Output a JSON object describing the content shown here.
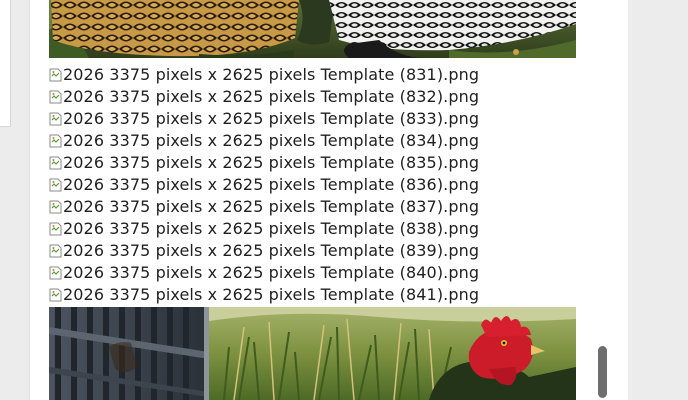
{
  "page": {
    "background": "#ececec",
    "card_background": "#ffffff"
  },
  "photos": {
    "top": {
      "icon": "chicken-photo",
      "subject": "speckled hens"
    },
    "bottom": {
      "icon": "rooster-photo",
      "subject": "rooster near fence"
    }
  },
  "broken_images": [
    {
      "alt": "2026 3375 pixels x 2625 pixels Template (831).png"
    },
    {
      "alt": "2026 3375 pixels x 2625 pixels Template (832).png"
    },
    {
      "alt": "2026 3375 pixels x 2625 pixels Template (833).png"
    },
    {
      "alt": "2026 3375 pixels x 2625 pixels Template (834).png"
    },
    {
      "alt": "2026 3375 pixels x 2625 pixels Template (835).png"
    },
    {
      "alt": "2026 3375 pixels x 2625 pixels Template (836).png"
    },
    {
      "alt": "2026 3375 pixels x 2625 pixels Template (837).png"
    },
    {
      "alt": "2026 3375 pixels x 2625 pixels Template (838).png"
    },
    {
      "alt": "2026 3375 pixels x 2625 pixels Template (839).png"
    },
    {
      "alt": "2026 3375 pixels x 2625 pixels Template (840).png"
    },
    {
      "alt": "2026 3375 pixels x 2625 pixels Template (841).png"
    }
  ],
  "scrollbar": {
    "thumb_color": "#6e6e6e"
  }
}
